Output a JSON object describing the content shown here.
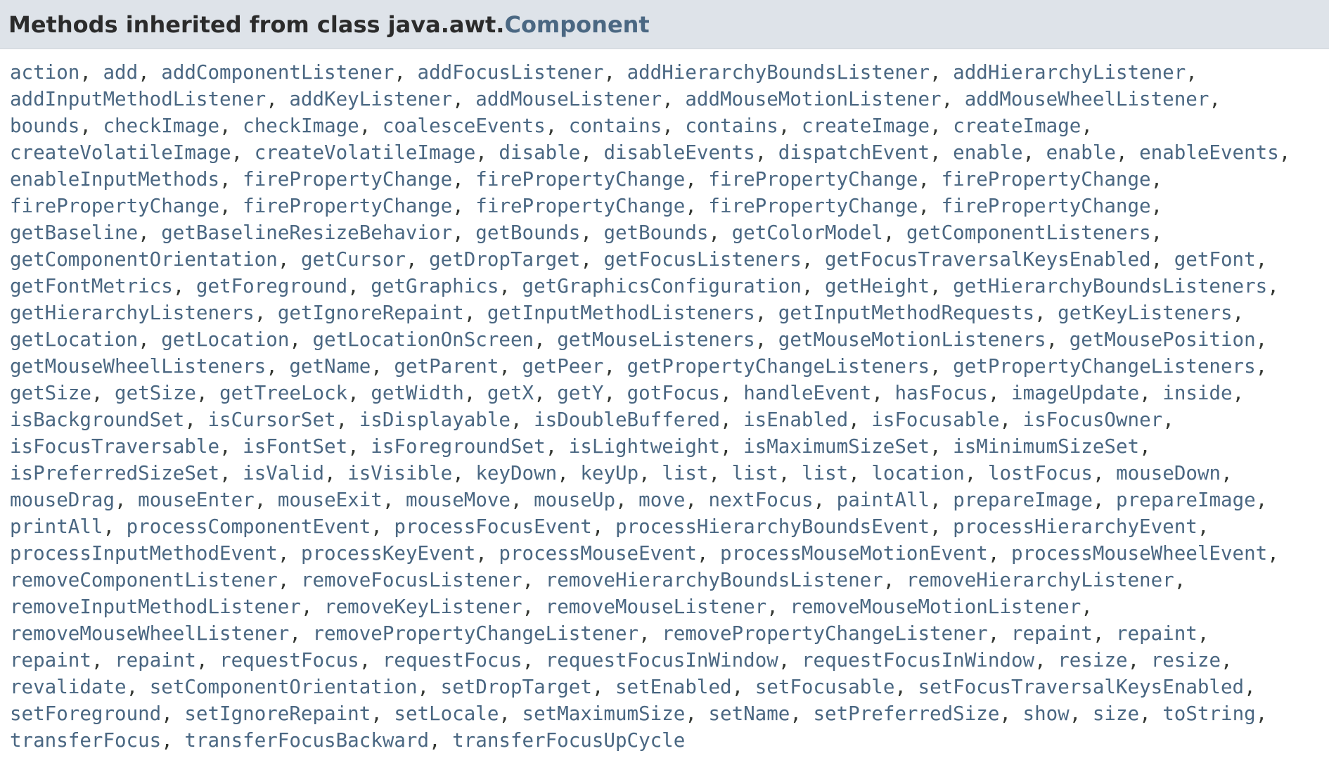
{
  "header": {
    "prefix": "Methods inherited from class java.awt.",
    "class_name": "Component"
  },
  "colors": {
    "header_background": "#dee3e9",
    "link": "#4a6782",
    "text": "#353833"
  },
  "methods": [
    [
      "action",
      "add",
      "addComponentListener",
      "addFocusListener",
      "addHierarchyBoundsListener",
      "addHierarchyListener"
    ],
    [
      "addInputMethodListener",
      "addKeyListener",
      "addMouseListener",
      "addMouseMotionListener",
      "addMouseWheelListener"
    ],
    [
      "bounds",
      "checkImage",
      "checkImage",
      "coalesceEvents",
      "contains",
      "contains",
      "createImage",
      "createImage"
    ],
    [
      "createVolatileImage",
      "createVolatileImage",
      "disable",
      "disableEvents",
      "dispatchEvent",
      "enable",
      "enable",
      "enableEvents"
    ],
    [
      "enableInputMethods",
      "firePropertyChange",
      "firePropertyChange",
      "firePropertyChange",
      "firePropertyChange"
    ],
    [
      "firePropertyChange",
      "firePropertyChange",
      "firePropertyChange",
      "firePropertyChange",
      "firePropertyChange"
    ],
    [
      "getBaseline",
      "getBaselineResizeBehavior",
      "getBounds",
      "getBounds",
      "getColorModel",
      "getComponentListeners"
    ],
    [
      "getComponentOrientation",
      "getCursor",
      "getDropTarget",
      "getFocusListeners",
      "getFocusTraversalKeysEnabled",
      "getFont"
    ],
    [
      "getFontMetrics",
      "getForeground",
      "getGraphics",
      "getGraphicsConfiguration",
      "getHeight",
      "getHierarchyBoundsListeners"
    ],
    [
      "getHierarchyListeners",
      "getIgnoreRepaint",
      "getInputMethodListeners",
      "getInputMethodRequests",
      "getKeyListeners"
    ],
    [
      "getLocation",
      "getLocation",
      "getLocationOnScreen",
      "getMouseListeners",
      "getMouseMotionListeners",
      "getMousePosition"
    ],
    [
      "getMouseWheelListeners",
      "getName",
      "getParent",
      "getPeer",
      "getPropertyChangeListeners",
      "getPropertyChangeListeners"
    ],
    [
      "getSize",
      "getSize",
      "getTreeLock",
      "getWidth",
      "getX",
      "getY",
      "gotFocus",
      "handleEvent",
      "hasFocus",
      "imageUpdate",
      "inside"
    ],
    [
      "isBackgroundSet",
      "isCursorSet",
      "isDisplayable",
      "isDoubleBuffered",
      "isEnabled",
      "isFocusable",
      "isFocusOwner"
    ],
    [
      "isFocusTraversable",
      "isFontSet",
      "isForegroundSet",
      "isLightweight",
      "isMaximumSizeSet",
      "isMinimumSizeSet"
    ],
    [
      "isPreferredSizeSet",
      "isValid",
      "isVisible",
      "keyDown",
      "keyUp",
      "list",
      "list",
      "list",
      "location",
      "lostFocus",
      "mouseDown"
    ],
    [
      "mouseDrag",
      "mouseEnter",
      "mouseExit",
      "mouseMove",
      "mouseUp",
      "move",
      "nextFocus",
      "paintAll",
      "prepareImage",
      "prepareImage"
    ],
    [
      "printAll",
      "processComponentEvent",
      "processFocusEvent",
      "processHierarchyBoundsEvent",
      "processHierarchyEvent"
    ],
    [
      "processInputMethodEvent",
      "processKeyEvent",
      "processMouseEvent",
      "processMouseMotionEvent",
      "processMouseWheelEvent"
    ],
    [
      "removeComponentListener",
      "removeFocusListener",
      "removeHierarchyBoundsListener",
      "removeHierarchyListener"
    ],
    [
      "removeInputMethodListener",
      "removeKeyListener",
      "removeMouseListener",
      "removeMouseMotionListener"
    ],
    [
      "removeMouseWheelListener",
      "removePropertyChangeListener",
      "removePropertyChangeListener",
      "repaint",
      "repaint"
    ],
    [
      "repaint",
      "repaint",
      "requestFocus",
      "requestFocus",
      "requestFocusInWindow",
      "requestFocusInWindow",
      "resize",
      "resize"
    ],
    [
      "revalidate",
      "setComponentOrientation",
      "setDropTarget",
      "setEnabled",
      "setFocusable",
      "setFocusTraversalKeysEnabled"
    ],
    [
      "setForeground",
      "setIgnoreRepaint",
      "setLocale",
      "setMaximumSize",
      "setName",
      "setPreferredSize",
      "show",
      "size",
      "toString"
    ],
    [
      "transferFocus",
      "transferFocusBackward",
      "transferFocusUpCycle"
    ]
  ]
}
